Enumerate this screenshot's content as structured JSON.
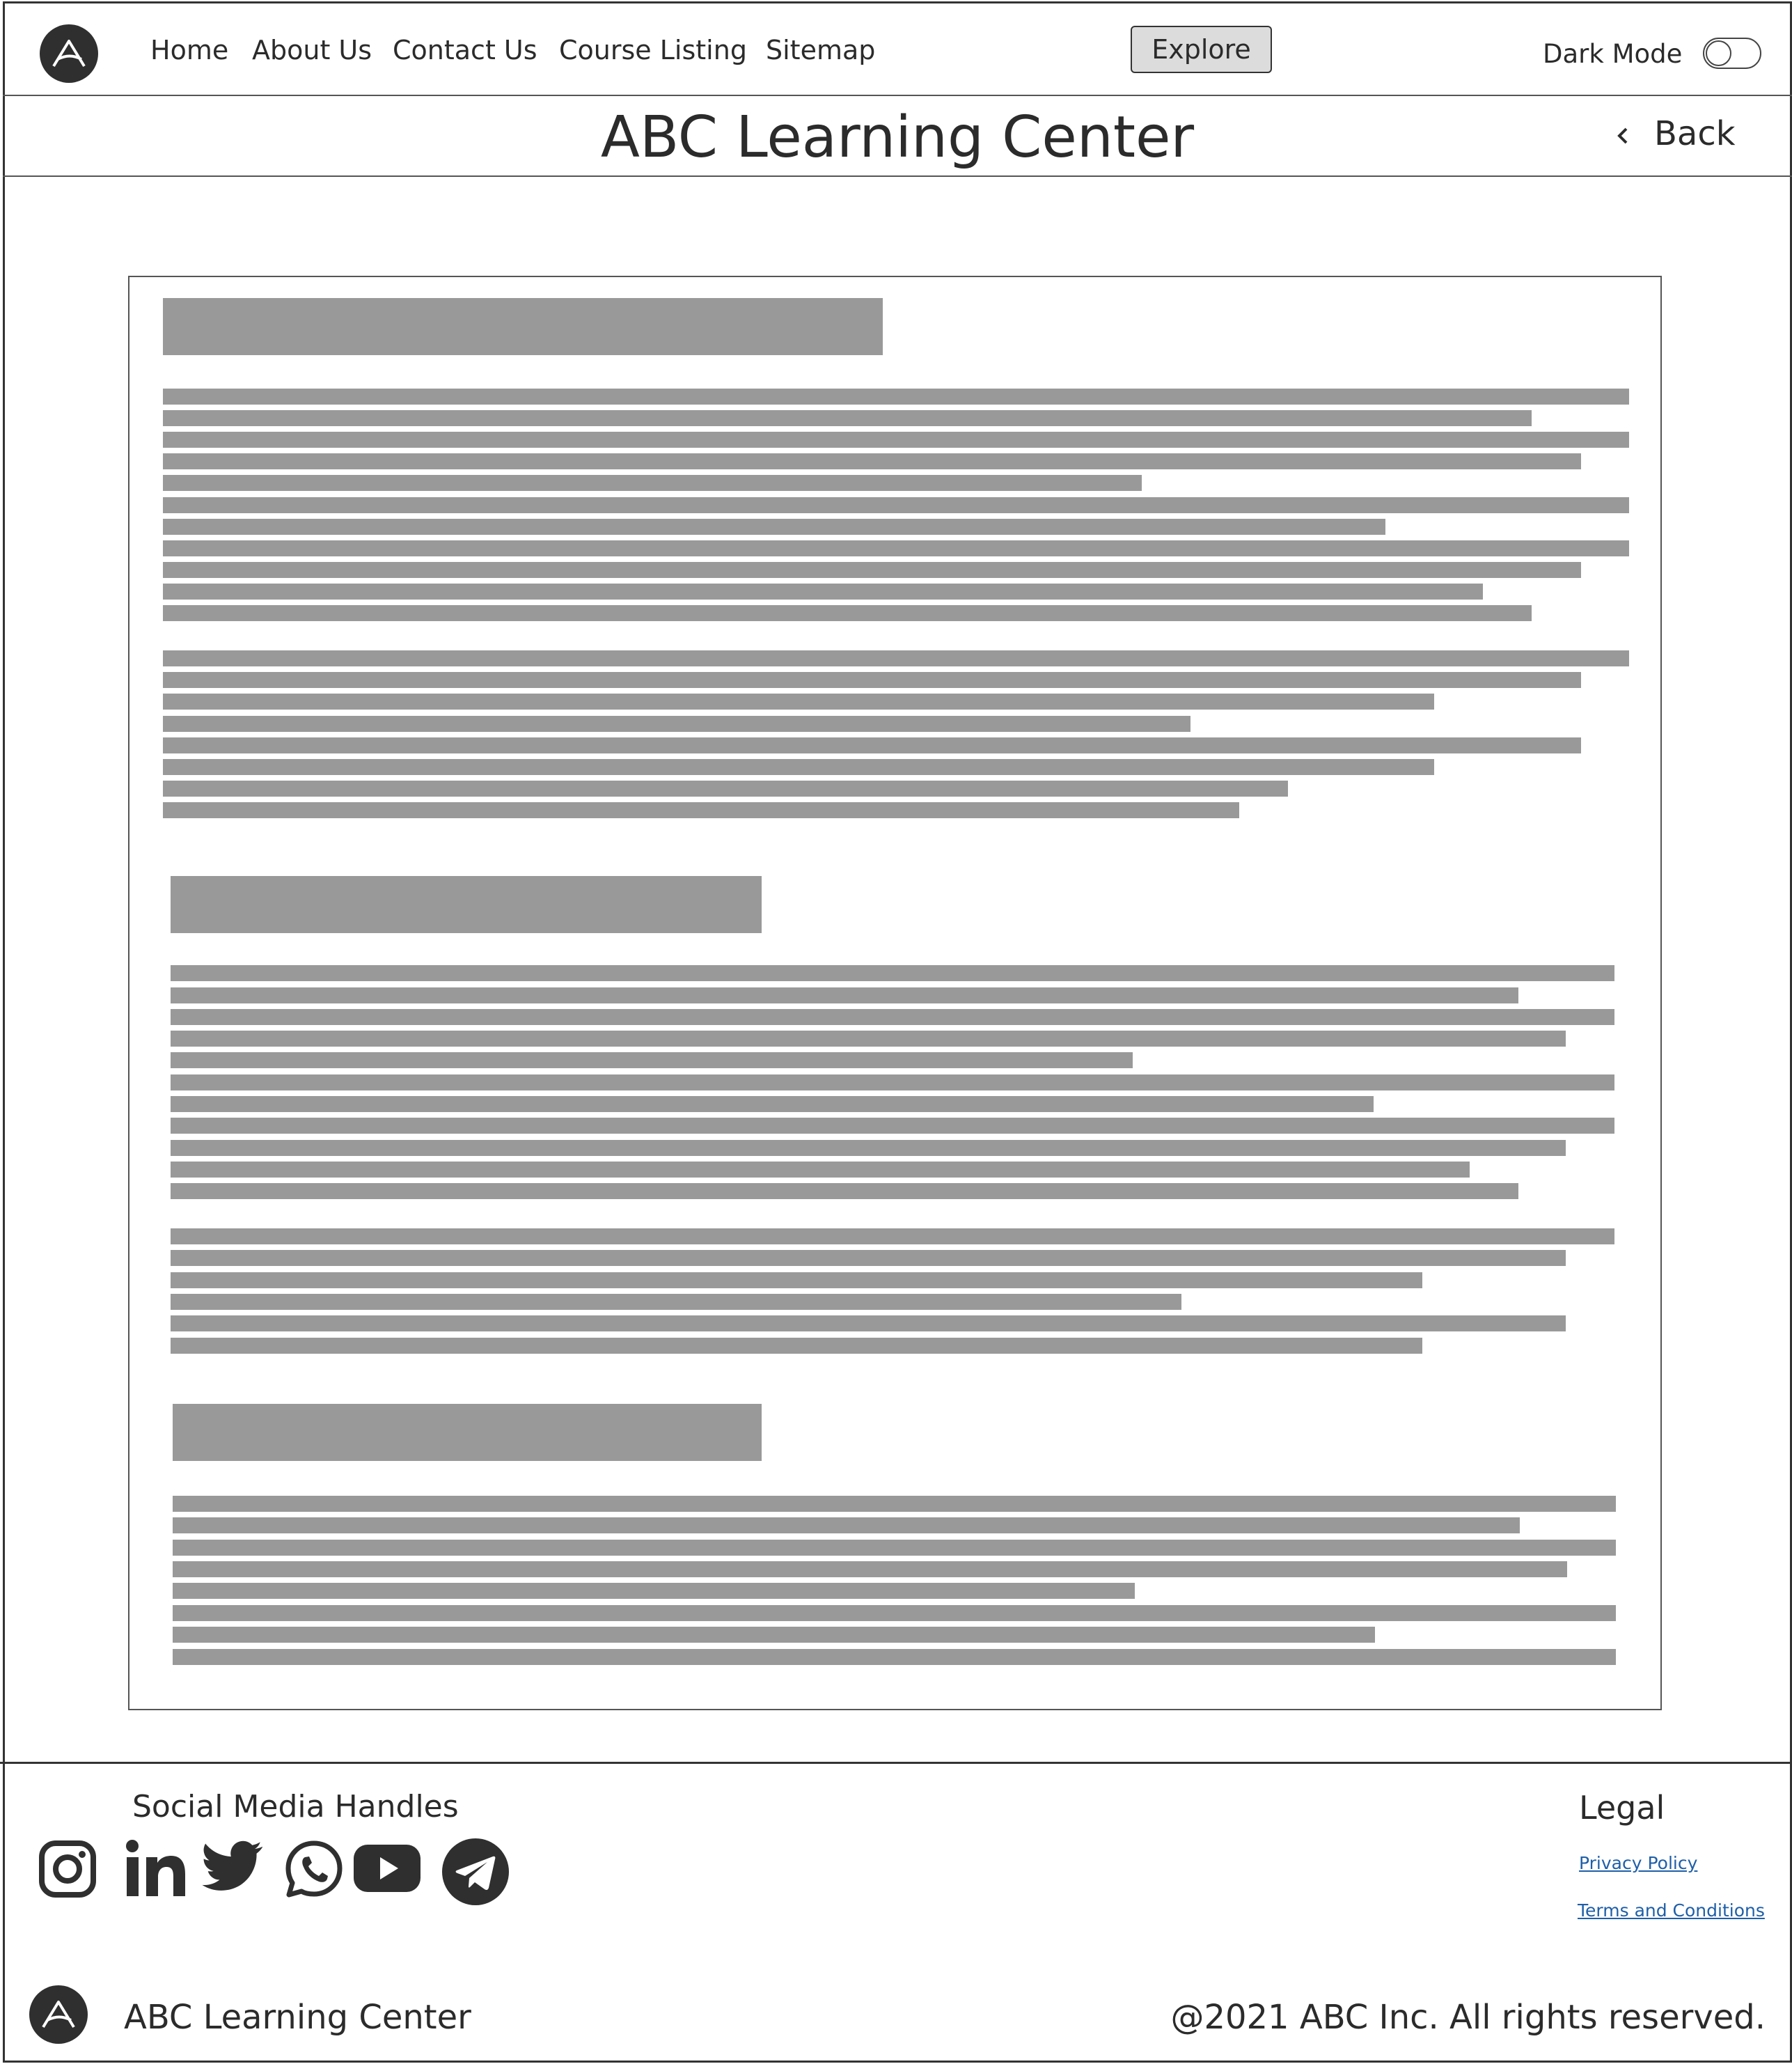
{
  "header": {
    "logo_icon": "a-logo-icon",
    "nav": [
      {
        "label": "Home"
      },
      {
        "label": "About Us"
      },
      {
        "label": "Contact Us"
      },
      {
        "label": "Course Listing"
      },
      {
        "label": "Sitemap"
      }
    ],
    "explore_label": "Explore",
    "dark_mode_label": "Dark Mode",
    "dark_mode_on": false
  },
  "titlebar": {
    "title": "ABC Learning Center",
    "back_label": "Back",
    "back_icon": "chevron-left-icon"
  },
  "content": {
    "placeholder_color": "#999999",
    "sections": 3
  },
  "footer": {
    "social_title": "Social Media Handles",
    "social_icons": [
      "instagram-icon",
      "linkedin-icon",
      "twitter-icon",
      "whatsapp-icon",
      "youtube-icon",
      "telegram-icon"
    ],
    "legal_title": "Legal",
    "legal_links": [
      {
        "label": "Privacy Policy"
      },
      {
        "label": "Terms and Conditions"
      }
    ],
    "link_color": "#1f5fa8",
    "brand": "ABC Learning Center",
    "copyright": "@2021 ABC Inc. All rights reserved."
  }
}
